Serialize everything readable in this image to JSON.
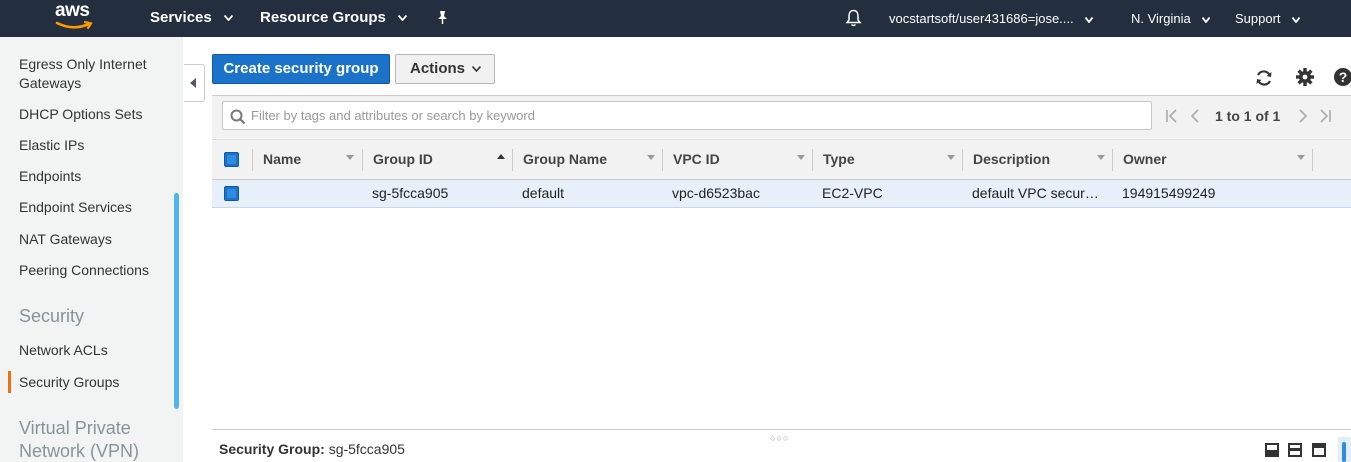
{
  "topnav": {
    "logo": "aws",
    "services": "Services",
    "resource_groups": "Resource Groups",
    "account": "vocstartsoft/user431686=jose....",
    "region": "N. Virginia",
    "support": "Support",
    "icons": [
      "pin-icon",
      "bell-icon"
    ]
  },
  "sidebar": {
    "items": [
      "Egress Only Internet Gateways",
      "DHCP Options Sets",
      "Elastic IPs",
      "Endpoints",
      "Endpoint Services",
      "NAT Gateways",
      "Peering Connections"
    ],
    "security_heading": "Security",
    "security_items": [
      "Network ACLs",
      "Security Groups"
    ],
    "active": "Security Groups",
    "vpn_heading": "Virtual Private Network (VPN)"
  },
  "toolbar": {
    "create_label": "Create security group",
    "actions_label": "Actions",
    "primary_color": "#1a73c8"
  },
  "filter": {
    "placeholder": "Filter by tags and attributes or search by keyword",
    "value": ""
  },
  "pagination": {
    "text": "1 to 1 of 1"
  },
  "table": {
    "columns": [
      "Name",
      "Group ID",
      "Group Name",
      "VPC ID",
      "Type",
      "Description",
      "Owner"
    ],
    "sorted_column": "Group ID",
    "rows": [
      {
        "name": "",
        "group_id": "sg-5fcca905",
        "group_name": "default",
        "vpc_id": "vpc-d6523bac",
        "type": "EC2-VPC",
        "description": "default VPC secur…",
        "owner": "194915499249",
        "selected": true
      }
    ]
  },
  "detail": {
    "label": "Security Group:",
    "value": "sg-5fcca905"
  }
}
